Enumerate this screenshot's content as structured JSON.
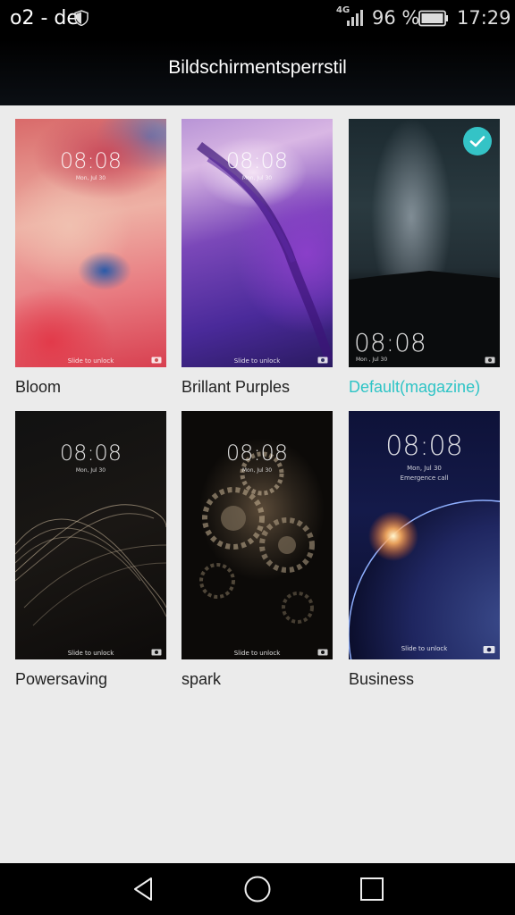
{
  "status_bar": {
    "carrier": "o2 - de",
    "network_type": "4G",
    "battery_percent": "96 %",
    "time": "17:29"
  },
  "header": {
    "title": "Bildschirmentsperrstil"
  },
  "styles": [
    {
      "name": "Bloom",
      "time": "08:08",
      "date": "Mon, Jul 30",
      "unlock": "Slide to unlock",
      "selected": false
    },
    {
      "name": "Brillant Purples",
      "time": "08:08",
      "date": "Mon, Jul 30",
      "unlock": "Slide to unlock",
      "selected": false
    },
    {
      "name": "Default(magazine)",
      "time": "08:08",
      "date": "Mon , Jul 30",
      "unlock": "",
      "selected": true
    },
    {
      "name": "Powersaving",
      "time": "08:08",
      "date": "Mon, Jul 30",
      "unlock": "Slide to unlock",
      "selected": false
    },
    {
      "name": "spark",
      "time": "08:08",
      "date": "Mon, Jul 30",
      "unlock": "Slide to unlock",
      "selected": false
    },
    {
      "name": "Business",
      "time": "08:08",
      "date": "Mon, Jul 30",
      "extra": "Emergence call",
      "unlock": "Slide to unlock",
      "selected": false
    }
  ],
  "nav_bar": {
    "icons": [
      "back-icon",
      "home-icon",
      "recents-icon"
    ]
  },
  "colors": {
    "accent": "#34c3c6",
    "background": "#ebebeb"
  }
}
